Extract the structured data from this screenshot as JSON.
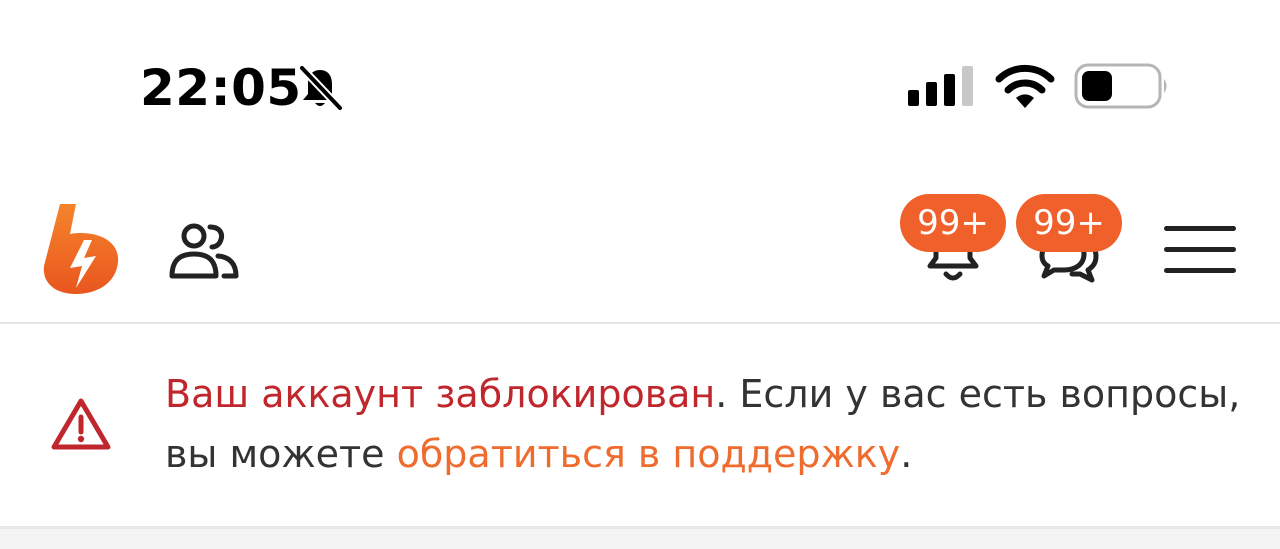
{
  "status_bar": {
    "time": "22:05",
    "icons": [
      "bell-slash-icon",
      "cellular-signal-icon",
      "wifi-icon",
      "battery-icon"
    ]
  },
  "header": {
    "logo_icon": "lightning-logo",
    "friends_icon": "people-icon",
    "notifications": {
      "icon": "bell-icon",
      "badge": "99+"
    },
    "messages": {
      "icon": "chat-bubbles-icon",
      "badge": "99+"
    },
    "menu_icon": "hamburger-menu-icon"
  },
  "banner": {
    "icon": "warning-triangle-icon",
    "blocked_text": "Ваш аккаунт заблокирован",
    "after_blocked": ". Если у вас есть вопросы,",
    "line2_prefix": "вы можете ",
    "support_link": "обратиться в поддержку",
    "line2_suffix": "."
  },
  "colors": {
    "accent": "#f0602a",
    "link": "#ef6c2e",
    "error": "#c0272d",
    "text": "#333333",
    "icon_dark": "#222222"
  }
}
